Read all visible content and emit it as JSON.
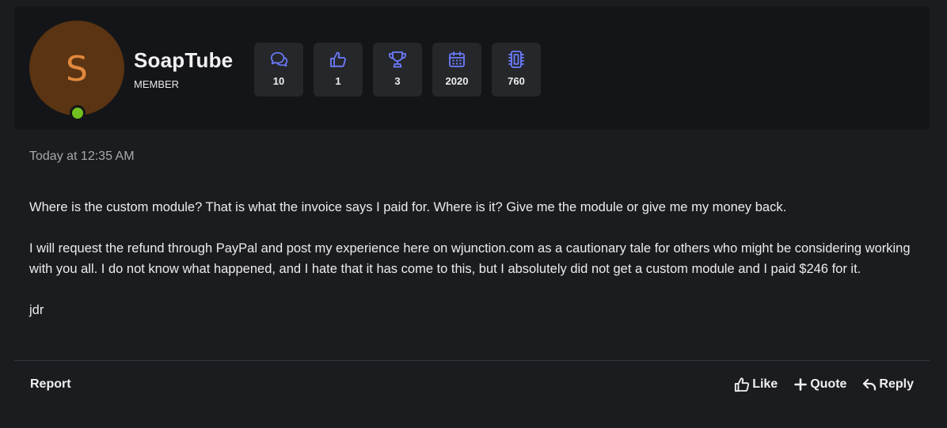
{
  "user": {
    "avatar_letter": "S",
    "name": "SoapTube",
    "role": "MEMBER",
    "online": true
  },
  "stats": [
    {
      "icon": "messages-icon",
      "value": "10"
    },
    {
      "icon": "thumbs-up-icon",
      "value": "1"
    },
    {
      "icon": "trophy-icon",
      "value": "3"
    },
    {
      "icon": "calendar-icon",
      "value": "2020"
    },
    {
      "icon": "chip-icon",
      "value": "760"
    }
  ],
  "post": {
    "timestamp": "Today at 12:35 AM",
    "paragraphs": [
      "Where is the custom module? That is what the invoice says I paid for. Where is it? Give me the module or give me my money back.",
      "I will request the refund through PayPal and post my experience here on wjunction.com as a cautionary tale for others who might be considering working with you all. I do not know what happened, and I hate that it has come to this, but I absolutely did not get a custom module and I paid $246 for it.",
      "jdr"
    ]
  },
  "footer": {
    "report_label": "Report",
    "like_label": "Like",
    "quote_label": "Quote",
    "reply_label": "Reply"
  },
  "colors": {
    "accent_icon": "#6b7cff",
    "avatar_bg": "#5a3413",
    "avatar_letter": "#e0883d",
    "online": "#72c11f"
  }
}
